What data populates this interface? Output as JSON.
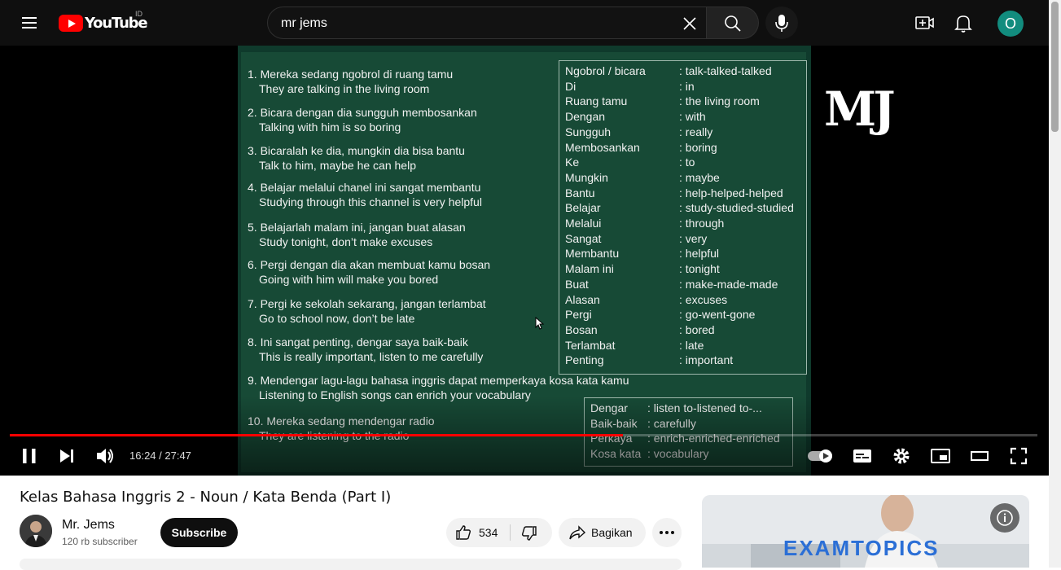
{
  "header": {
    "logo_text": "YouTube",
    "country_code": "ID",
    "search_value": "mr jems"
  },
  "video": {
    "board": {
      "sentences": [
        {
          "id": "Mereka sedang ngobrol di ruang tamu",
          "en": "They  are  talking   in the living room",
          "num": "1."
        },
        {
          "id": "Bicara dengan dia sungguh membosankan",
          "en": "Talking   with  him  is   so   boring",
          "num": "2."
        },
        {
          "id": " Bicaralah ke dia, mungkin dia bisa bantu",
          "en": " Talk  to him,  maybe   he  can  help",
          "num": "3."
        },
        {
          "id": "Belajar melalui chanel ini sangat membantu",
          "en": "Studying  through  this channel  is  very  helpful",
          "num": "4."
        },
        {
          "id": "Belajarlah malam ini, jangan buat alasan",
          "en": "Study tonight, don’t  make  excuses",
          "num": "5."
        },
        {
          "id": "Pergi dengan dia akan membuat kamu bosan",
          "en": "Going  with him  will  make  you  bored",
          "num": "6."
        },
        {
          "id": "Pergi ke sekolah sekarang, jangan terlambat",
          "en": "Go to school   now,  don’t  be late",
          "num": "7."
        },
        {
          "id": "Ini sangat penting, dengar saya baik-baik",
          "en": "This  is  really  important,  listen to me  carefully",
          "num": "8."
        },
        {
          "id": "Mendengar lagu-lagu bahasa inggris dapat memperkaya kosa kata kamu",
          "en": "Listening to  English songs  can enrich  your  vocabulary",
          "num": "9."
        },
        {
          "id": "Mereka sedang mendengar radio",
          "en": " They  are  listening to  the radio",
          "num": "10."
        }
      ],
      "vocab": [
        {
          "w": "Ngobrol / bicara",
          "m": ": talk-talked-talked"
        },
        {
          "w": "Di",
          "m": ": in"
        },
        {
          "w": "Ruang tamu",
          "m": ": the living room"
        },
        {
          "w": "Dengan",
          "m": ": with"
        },
        {
          "w": "Sungguh",
          "m": ": really"
        },
        {
          "w": "Membosankan",
          "m": ": boring"
        },
        {
          "w": "Ke",
          "m": ": to"
        },
        {
          "w": "Mungkin",
          "m": ": maybe"
        },
        {
          "w": "Bantu",
          "m": ": help-helped-helped"
        },
        {
          "w": "Belajar",
          "m": ": study-studied-studied"
        },
        {
          "w": "Melalui",
          "m": ": through"
        },
        {
          "w": "Sangat",
          "m": ": very"
        },
        {
          "w": "Membantu",
          "m": ": helpful"
        },
        {
          "w": "Malam ini",
          "m": ": tonight"
        },
        {
          "w": "Buat",
          "m": ": make-made-made"
        },
        {
          "w": "Alasan",
          "m": ": excuses"
        },
        {
          "w": "Pergi",
          "m": ": go-went-gone"
        },
        {
          "w": "Bosan",
          "m": ": bored"
        },
        {
          "w": "Terlambat",
          "m": ": late"
        },
        {
          "w": "Penting",
          "m": ": important"
        }
      ],
      "vocab2": [
        {
          "w": "Dengar",
          "m": ": listen to-listened to-..."
        },
        {
          "w": "Baik-baik",
          "m": ": carefully"
        },
        {
          "w": "Perkaya",
          "m": ": enrich-enriched-enriched"
        },
        {
          "w": "Kosa kata",
          "m": ": vocabulary"
        }
      ],
      "watermark": "MJ"
    },
    "progress_fraction": 0.5965,
    "time_display": "16:24 / 27:47",
    "title": "Kelas Bahasa Inggris 2 - Noun / Kata Benda (Part I)"
  },
  "channel": {
    "name": "Mr. Jems",
    "subscribers": "120 rb subscriber",
    "subscribe_label": "Subscribe"
  },
  "actions": {
    "like_count": "534",
    "share_label": "Bagikan"
  },
  "ad": {
    "brand_text": "EXAMTOPICS"
  },
  "colors": {
    "accent": "#ff0000",
    "board": "#174a36",
    "avatar_bg": "#128c7e"
  }
}
